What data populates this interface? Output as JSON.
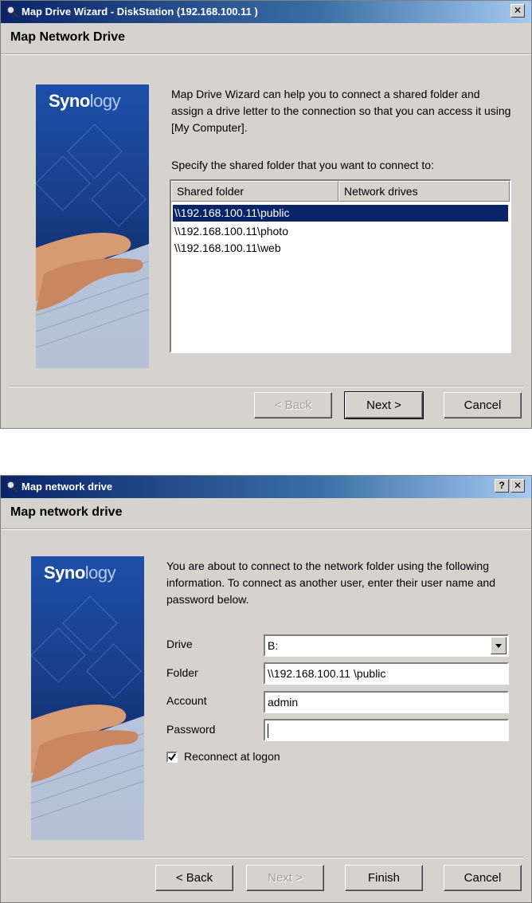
{
  "dialog1": {
    "title": "Map Drive Wizard - DiskStation (192.168.100.11  )",
    "close_label": "✕",
    "header": "Map Network Drive",
    "logo": {
      "main": "Syno",
      "accent": "logy"
    },
    "description": "Map Drive Wizard can help you to connect a shared folder and assign a drive letter to the connection so that you can access it using [My Computer].",
    "prompt": "Specify the shared folder that you want to connect to:",
    "columns": [
      "Shared folder",
      "Network drives"
    ],
    "rows": [
      "\\\\192.168.100.11\\public",
      "\\\\192.168.100.11\\photo",
      "\\\\192.168.100.11\\web"
    ],
    "selected_row": 0,
    "buttons": {
      "back": "< Back",
      "next": "Next >",
      "cancel": "Cancel"
    }
  },
  "dialog2": {
    "title": "Map network drive",
    "help_label": "?",
    "close_label": "✕",
    "header": "Map network drive",
    "logo": {
      "main": "Syno",
      "accent": "logy"
    },
    "description": "You are about to connect to the network folder using the following information. To connect as another user, enter their user name and password below.",
    "drive_label": "Drive",
    "drive_value": "B:",
    "folder_label": "Folder",
    "folder_value": "\\\\192.168.100.11 \\public",
    "account_label": "Account",
    "account_value": "admin",
    "password_label": "Password",
    "password_value": "",
    "reconnect_label": "Reconnect at logon",
    "reconnect_checked": true,
    "buttons": {
      "back": "< Back",
      "next": "Next >",
      "finish": "Finish",
      "cancel": "Cancel"
    }
  },
  "colors": {
    "selection": "#0a246a",
    "dialog_bg": "#d6d3ce",
    "banner_blue": "#1a3f8c"
  }
}
